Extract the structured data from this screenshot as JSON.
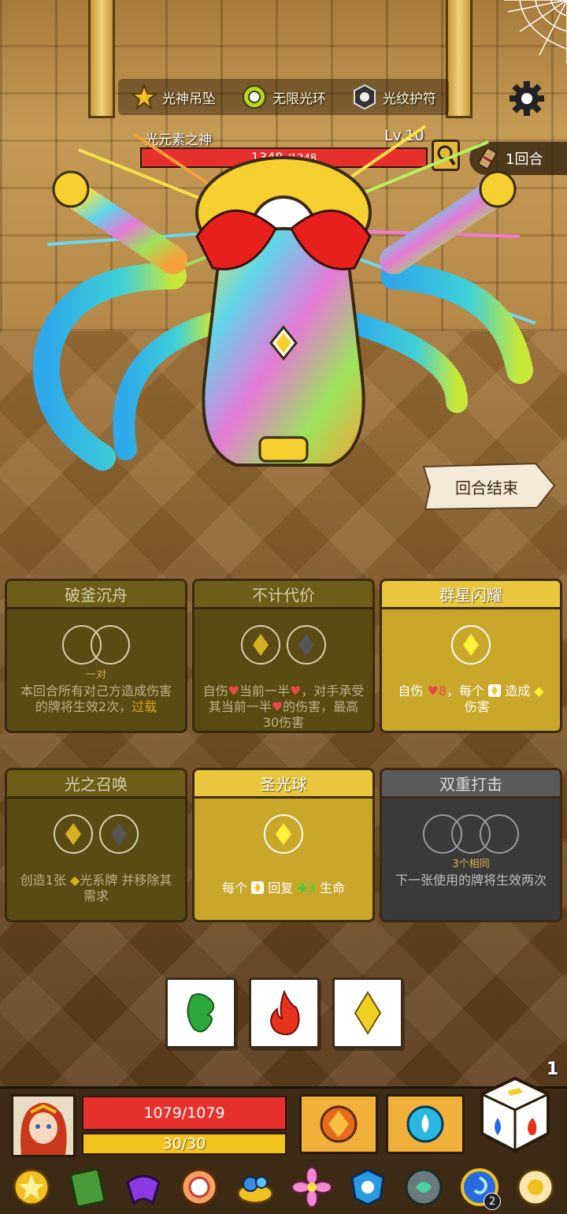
{
  "relics": [
    {
      "name": "光神吊坠",
      "icon": "star-pendant-icon"
    },
    {
      "name": "无限光环",
      "icon": "halo-ring-icon"
    },
    {
      "name": "光纹护符",
      "icon": "amulet-icon"
    }
  ],
  "settings_icon": "gear-icon",
  "boss": {
    "name": "光元素之神",
    "level": "Lv.10",
    "hp_text": "1348",
    "hp_max_text": "/1348",
    "hp_fraction": 1.0,
    "inspect_icon": "magnifier-icon"
  },
  "round": {
    "label": "1回合",
    "icon": "scroll-icon"
  },
  "end_turn": {
    "label": "回合结束"
  },
  "cards": [
    {
      "title": "破釜沉舟",
      "state": "dim",
      "requirement": "一对",
      "desc_parts": [
        "本回合所有对己方造成伤害的牌将生效2次，",
        "过载"
      ]
    },
    {
      "title": "不计代价",
      "state": "dim",
      "desc_parts": [
        "自伤",
        "当前一半",
        "，对手承受其当前一半",
        "的伤害，最高30伤害"
      ]
    },
    {
      "title": "群星闪耀",
      "state": "lit",
      "desc_parts": [
        "自伤",
        "8",
        "，每个",
        "造成",
        "7",
        "伤害"
      ]
    },
    {
      "title": "光之召唤",
      "state": "dim",
      "desc_parts": [
        "创造1张",
        "光系牌 并移除其需求"
      ]
    },
    {
      "title": "圣光球",
      "state": "lit",
      "desc_parts": [
        "每个",
        "回复",
        "3",
        "生命"
      ]
    },
    {
      "title": "双重打击",
      "state": "gray",
      "requirement": "3个相同",
      "desc_parts": [
        "下一张使用的牌将生效两次"
      ]
    }
  ],
  "dice": [
    {
      "face": "leaf",
      "color": "#2aa83a"
    },
    {
      "face": "fire",
      "color": "#e8331c"
    },
    {
      "face": "light",
      "color": "#f2cf24"
    }
  ],
  "dice_remaining": "1",
  "player": {
    "hp_text": "1079/1079",
    "hp_fraction": 1.0,
    "energy_text": "30/30",
    "energy_fraction": 1.0
  },
  "skills": [
    {
      "icon": "orange-gem-icon"
    },
    {
      "icon": "water-orb-icon"
    }
  ],
  "inventory": [
    {
      "icon": "sun-badge-icon"
    },
    {
      "icon": "green-tome-icon"
    },
    {
      "icon": "purple-bow-icon"
    },
    {
      "icon": "donut-icon"
    },
    {
      "icon": "blue-gem-pile-icon"
    },
    {
      "icon": "pink-flower-icon"
    },
    {
      "icon": "blue-crest-icon"
    },
    {
      "icon": "stone-rune-icon"
    },
    {
      "icon": "blue-swirl-icon",
      "badge": "2"
    },
    {
      "icon": "sun-disc-icon"
    }
  ],
  "colors": {
    "hp_red": "#e8312c",
    "energy_yellow": "#f2c21e",
    "card_lit": "#c9a72a",
    "card_dim": "#5a4a14",
    "card_gray": "#3a3a3a"
  }
}
